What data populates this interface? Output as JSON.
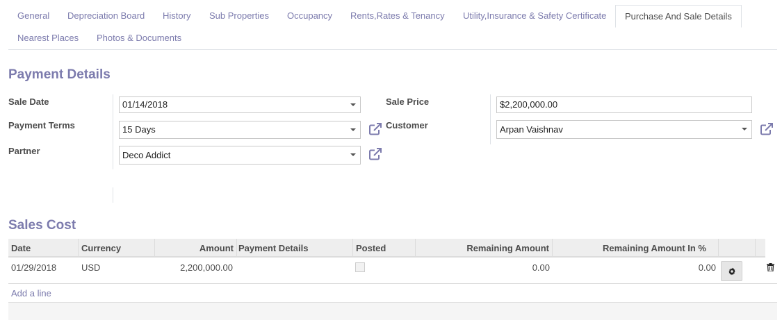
{
  "tabs": [
    {
      "label": "General"
    },
    {
      "label": "Depreciation Board"
    },
    {
      "label": "History"
    },
    {
      "label": "Sub Properties"
    },
    {
      "label": "Occupancy"
    },
    {
      "label": "Rents,Rates & Tenancy"
    },
    {
      "label": "Utility,Insurance & Safety Certificate"
    },
    {
      "label": "Purchase And Sale Details"
    },
    {
      "label": "Nearest Places"
    },
    {
      "label": "Photos & Documents"
    }
  ],
  "payment": {
    "title": "Payment Details",
    "sale_date_label": "Sale Date",
    "sale_date": "01/14/2018",
    "payment_terms_label": "Payment Terms",
    "payment_terms": "15 Days",
    "partner_label": "Partner",
    "partner": "Deco Addict",
    "sale_price_label": "Sale Price",
    "sale_price": "$2,200,000.00",
    "customer_label": "Customer",
    "customer": "Arpan Vaishnav"
  },
  "sales_cost": {
    "title": "Sales Cost",
    "columns": [
      "Date",
      "Currency",
      "Amount",
      "Payment Details",
      "Posted",
      "Remaining Amount",
      "Remaining Amount In %"
    ],
    "rows": [
      {
        "date": "01/29/2018",
        "currency": "USD",
        "amount": "2,200,000.00",
        "payment_details": "",
        "posted": false,
        "remaining": "0.00",
        "remaining_pct": "0.00"
      }
    ],
    "add_line": "Add a line"
  },
  "colors": {
    "accent": "#7c7bad",
    "text": "#4c4c4c"
  }
}
